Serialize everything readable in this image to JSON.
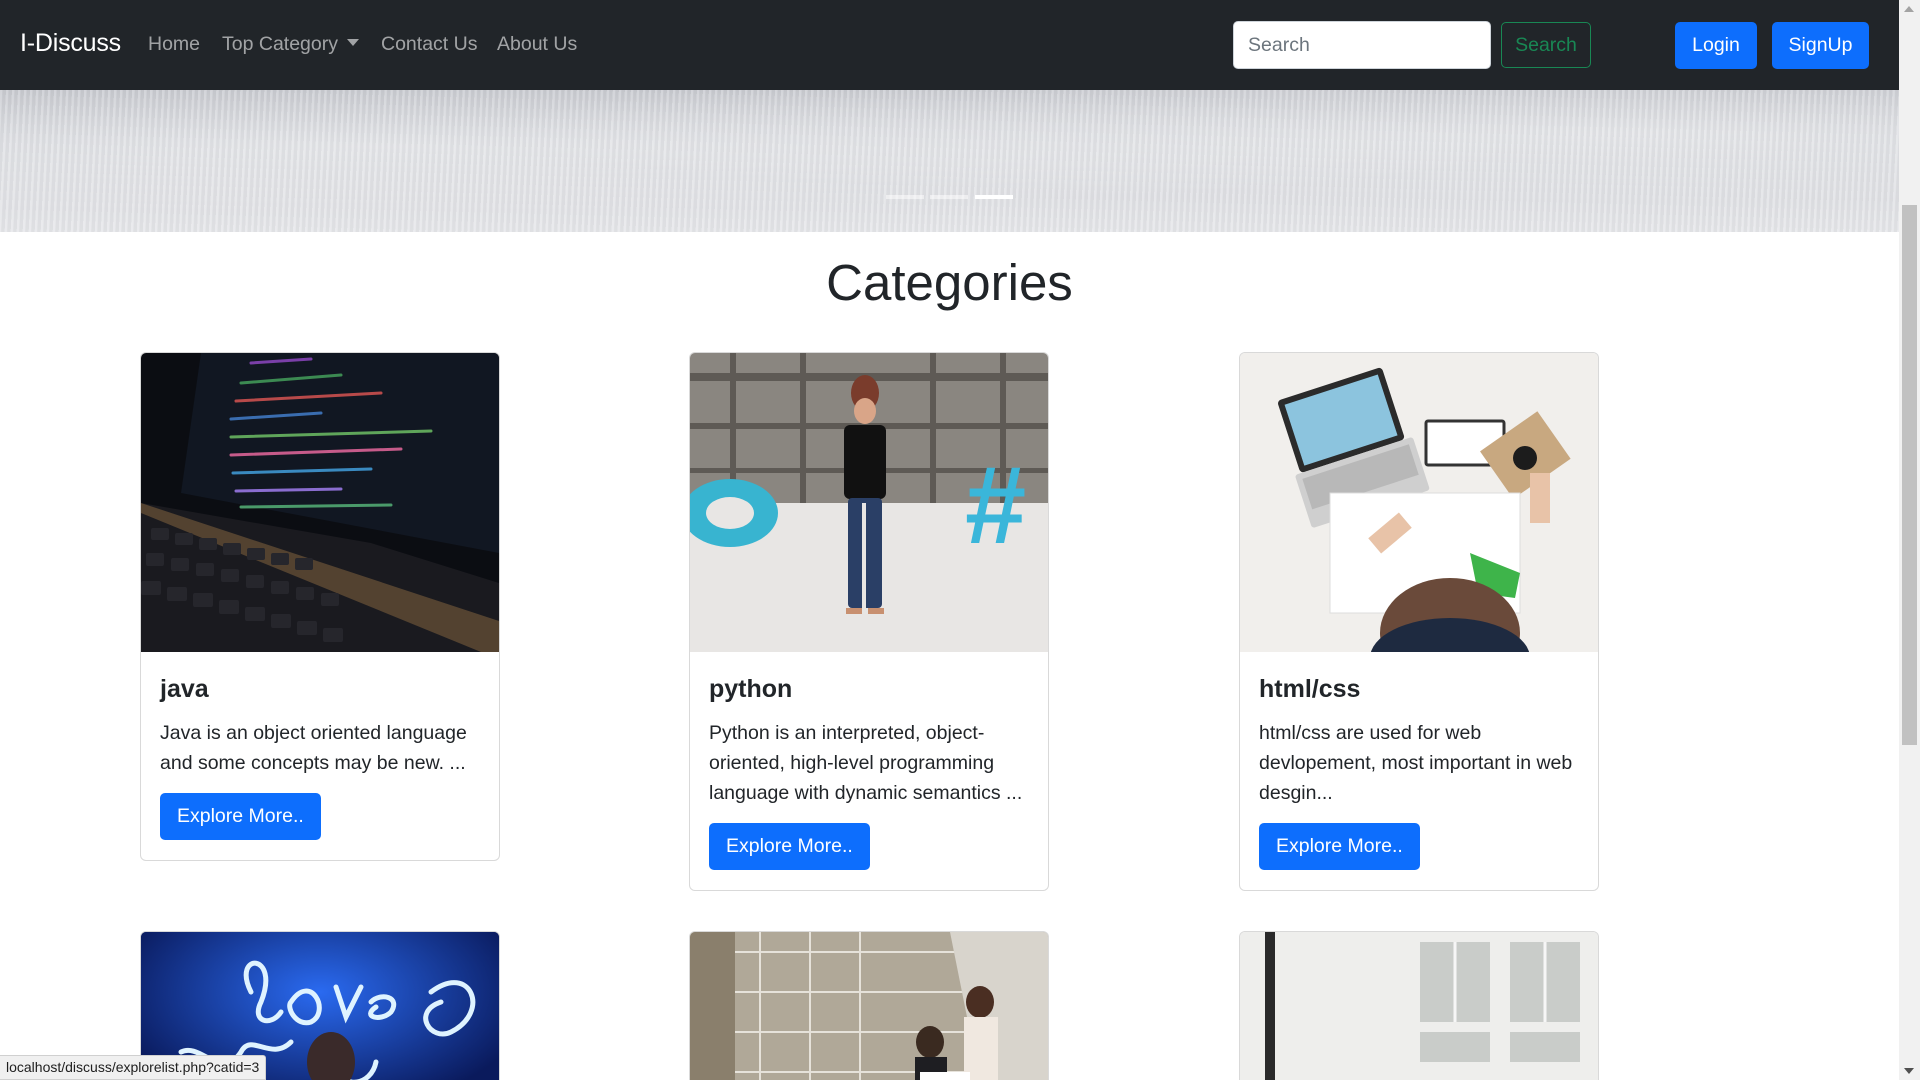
{
  "navbar": {
    "brand": "I-Discuss",
    "links": [
      "Home",
      "Top Category",
      "Contact Us",
      "About Us"
    ],
    "search_placeholder": "Search",
    "search_button": "Search",
    "login": "Login",
    "signup": "SignUp"
  },
  "carousel": {
    "slide_count": 3,
    "active_slide": 3
  },
  "section_title": "Categories",
  "cards": [
    {
      "title": "java",
      "text": "Java is an object oriented language and some concepts may be new. ...",
      "button": "Explore More.."
    },
    {
      "title": "python",
      "text": "Python is an interpreted, object-oriented, high-level programming language with dynamic semantics ...",
      "button": "Explore More.."
    },
    {
      "title": "html/css",
      "text": "html/css are used for web devlopement, most important in web desgin...",
      "button": "Explore More.."
    }
  ],
  "status_url": "localhost/discuss/explorelist.php?catid=3",
  "colors": {
    "navbar": "#212529",
    "primary": "#0d6efd",
    "success": "#198754"
  }
}
